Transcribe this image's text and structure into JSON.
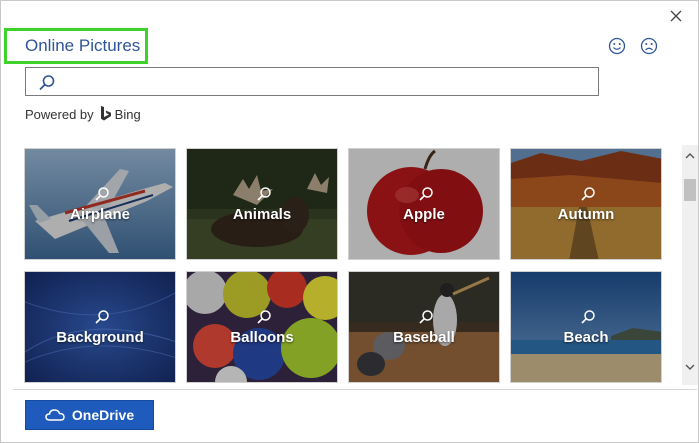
{
  "dialog": {
    "title": "Online Pictures",
    "close_icon": "close-icon",
    "feedback": [
      "smile-icon",
      "frown-icon"
    ]
  },
  "search": {
    "value": "",
    "placeholder": "",
    "icon": "search-icon"
  },
  "powered_by": {
    "label": "Powered by",
    "brand": "Bing"
  },
  "categories": [
    {
      "label": "Airplane"
    },
    {
      "label": "Animals"
    },
    {
      "label": "Apple"
    },
    {
      "label": "Autumn"
    },
    {
      "label": "Background"
    },
    {
      "label": "Balloons"
    },
    {
      "label": "Baseball"
    },
    {
      "label": "Beach"
    }
  ],
  "footer": {
    "onedrive_label": "OneDrive"
  },
  "colors": {
    "title": "#2f5597",
    "highlight_border": "#3fd22a",
    "onedrive_button": "#1e5bbd"
  }
}
